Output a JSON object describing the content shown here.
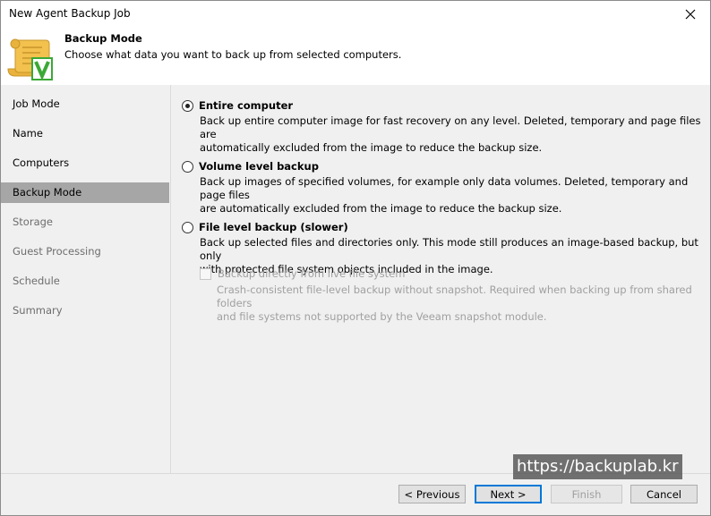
{
  "window": {
    "title": "New Agent Backup Job"
  },
  "header": {
    "title": "Backup Mode",
    "description": "Choose what data you want to back up from selected computers.",
    "icon": "scroll-veeam-icon"
  },
  "sidebar": {
    "items": [
      {
        "label": "Job Mode",
        "state": "enabled"
      },
      {
        "label": "Name",
        "state": "enabled"
      },
      {
        "label": "Computers",
        "state": "enabled"
      },
      {
        "label": "Backup Mode",
        "state": "active"
      },
      {
        "label": "Storage",
        "state": "disabled"
      },
      {
        "label": "Guest Processing",
        "state": "disabled"
      },
      {
        "label": "Schedule",
        "state": "disabled"
      },
      {
        "label": "Summary",
        "state": "disabled"
      }
    ]
  },
  "options": {
    "entire": {
      "label": "Entire computer",
      "checked": true,
      "line1": "Back up entire computer image for fast recovery on any level. Deleted, temporary and page files are",
      "line2": "automatically excluded from the image to reduce the backup size."
    },
    "volume": {
      "label": "Volume level backup",
      "checked": false,
      "line1": "Back up images of specified volumes, for example only data volumes. Deleted, temporary and page files",
      "line2": "are automatically excluded from the image to reduce the backup size."
    },
    "file": {
      "label": "File level backup (slower)",
      "checked": false,
      "line1": "Back up selected files and directories only. This mode still produces an image-based backup, but only",
      "line2": "with protected file system objects included in the image.",
      "sub_option": {
        "label": "Backup directly from live file system",
        "checked": false,
        "enabled": false,
        "line1": "Crash-consistent file-level backup without snapshot. Required when backing up from shared folders",
        "line2": "and file systems not supported by the Veeam snapshot module."
      }
    }
  },
  "footer": {
    "previous": "< Previous",
    "next": "Next >",
    "finish": "Finish",
    "cancel": "Cancel"
  },
  "watermark": "https://backuplab.kr",
  "colors": {
    "accent": "#0078d7",
    "sidebar_active": "#a6a6a6",
    "panel_bg": "#f0f0f0",
    "veeam_green": "#3aa935"
  }
}
